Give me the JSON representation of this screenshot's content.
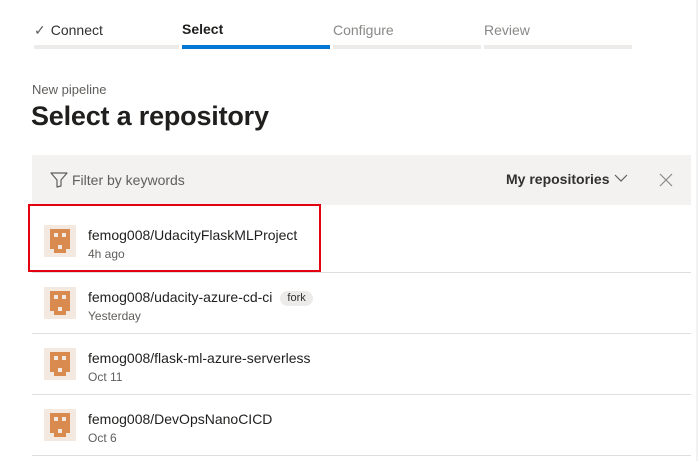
{
  "stepper": {
    "steps": [
      {
        "label": "Connect",
        "state": "done"
      },
      {
        "label": "Select",
        "state": "active"
      },
      {
        "label": "Configure",
        "state": "todo"
      },
      {
        "label": "Review",
        "state": "todo"
      }
    ]
  },
  "header": {
    "kicker": "New pipeline",
    "title": "Select a repository"
  },
  "filter": {
    "placeholder": "Filter by keywords",
    "scope": "My repositories"
  },
  "repositories": [
    {
      "name": "femog008/UdacityFlaskMLProject",
      "time": "4h ago",
      "badge": "",
      "highlighted": true
    },
    {
      "name": "femog008/udacity-azure-cd-ci",
      "time": "Yesterday",
      "badge": "fork",
      "highlighted": false
    },
    {
      "name": "femog008/flask-ml-azure-serverless",
      "time": "Oct 11",
      "badge": "",
      "highlighted": false
    },
    {
      "name": "femog008/DevOpsNanoCICD",
      "time": "Oct 6",
      "badge": "",
      "highlighted": false
    }
  ],
  "colors": {
    "accent": "#0078d4",
    "highlight": "#e3000f",
    "avatar": "#d98b4f"
  },
  "icons": {
    "filter": "filter-icon",
    "scope": "chevron-down-icon",
    "clear": "close-icon",
    "avatar": "identicon-avatar"
  }
}
